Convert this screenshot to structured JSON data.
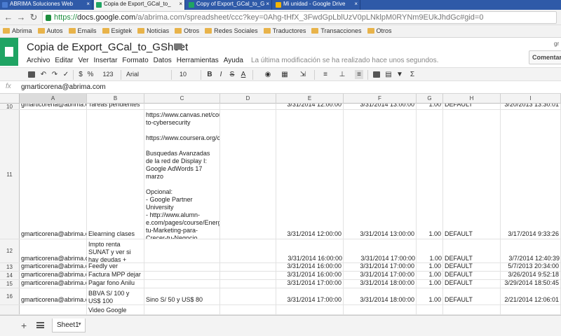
{
  "browser": {
    "tabs": [
      {
        "label": "ABRIMA Soluciones Web",
        "icon_color": "#4a7bd0",
        "active": false
      },
      {
        "label": "Copia de Export_GCal_to_",
        "icon_color": "#1fa463",
        "active": true
      },
      {
        "label": "Copy of Export_GCal_to_G",
        "icon_color": "#1fa463",
        "active": false
      },
      {
        "label": "Mi unidad - Google Drive",
        "icon_color": "#f4b400",
        "active": false
      }
    ],
    "url_scheme": "https://",
    "url_host": "docs.google.com",
    "url_path": "/a/abrima.com/spreadsheet/ccc?key=0Ahg-tHfX_3FwdGpLblUzV0pLNklpM0RYNm9EUkJhdGc#gid=0",
    "bookmarks": [
      "Abrima",
      "Autos",
      "Emails",
      "Esigtek",
      "Noticias",
      "Otros",
      "Redes Sociales",
      "Traductores",
      "Transacciones",
      "Otros"
    ]
  },
  "doc": {
    "title": "Copia de Export_GCal_to_GSheet",
    "menu": [
      "Archivo",
      "Editar",
      "Ver",
      "Insertar",
      "Formato",
      "Datos",
      "Herramientas",
      "Ayuda"
    ],
    "last_edit": "La última modificación se ha realizado hace unos segundos.",
    "comments_label": "Comentarios",
    "user_initials": "gr"
  },
  "toolbar": {
    "currency": "$",
    "percent": "%",
    "number_format": "123",
    "font": "Arial",
    "font_size": "10",
    "bold": "B",
    "italic": "I",
    "strike": "S",
    "text_color": "A",
    "sigma": "Σ"
  },
  "formula": {
    "fx": "fx",
    "value": "gmarticorena@abrima.com"
  },
  "columns": [
    "A",
    "B",
    "C",
    "D",
    "E",
    "F",
    "G",
    "H",
    "I"
  ],
  "rows": [
    {
      "num": "10",
      "cells": [
        "gmarticorena@abrima.co",
        "Tareas pendientes",
        "",
        "",
        "3/31/2014 12:00:00",
        "3/31/2014 13:00:00",
        "1.00",
        "DEFAULT",
        "3/20/2013 13:30:01"
      ]
    },
    {
      "num": "11",
      "cells": [
        "gmarticorena@abrima.co",
        "Elearning clases",
        "https://www.canvas.net/courses/intro-to-cybersecurity\n\nhttps://www.coursera.org/course\n\nBusquedas Avanzadas de la red de Display I: Google AdWords 17 marzo\n\nOpcional:\n- Google Partner University\n- http://www.alumn-e.com/pages/course/Energia-tu-Marketing-para-Crecer-tu-Negocio\n- Si no hay que hacer http://unimooc.com/",
        "",
        "3/31/2014 12:00:00",
        "3/31/2014 13:00:00",
        "1.00",
        "DEFAULT",
        "3/17/2014 9:33:26"
      ]
    },
    {
      "num": "12",
      "cells": [
        "",
        "Impto renta SUNAT y ver si hay deudas + chequera",
        "",
        "",
        "",
        "",
        "",
        "",
        ""
      ]
    },
    {
      "num": "13",
      "cells": [
        "gmarticorena@abrima.co",
        "Feedly ver",
        "",
        "",
        "3/31/2014 16:00:00",
        "3/31/2014 17:00:00",
        "1.00",
        "DEFAULT",
        "5/7/2013 20:34:00"
      ]
    },
    {
      "num": "14",
      "cells": [
        "gmarticorena@abrima.co",
        "Factura MPP dejar",
        "",
        "",
        "3/31/2014 16:00:00",
        "3/31/2014 17:00:00",
        "1.00",
        "DEFAULT",
        "3/26/2014 9:52:18"
      ]
    },
    {
      "num": "15",
      "cells": [
        "gmarticorena@abrima.co",
        "Pagar fono Anilu",
        "",
        "",
        "3/31/2014 17:00:00",
        "3/31/2014 18:00:00",
        "1.00",
        "DEFAULT",
        "3/29/2014 18:50:45"
      ]
    },
    {
      "num": "16",
      "cells": [
        "gmarticorena@abrima.co",
        "BBVA S/ 100 y US$ 100",
        "Sino S/ 50 y US$ 80",
        "",
        "3/31/2014 17:00:00",
        "3/31/2014 18:00:00",
        "1.00",
        "DEFAULT",
        "2/21/2014 12:06:01"
      ]
    },
    {
      "num": "",
      "cells": [
        "",
        "Video Google Adwords Búsqueda",
        "",
        "",
        "",
        "",
        "",
        "",
        ""
      ]
    }
  ],
  "row12_extra": {
    "e": "3/31/2014 16:00:00",
    "f": "3/31/2014 17:00:00",
    "g": "1.00",
    "h": "DEFAULT",
    "i": "3/7/2014 12:40:39",
    "a": "gmarticorena@abrima.co"
  },
  "sheet_tab": "Sheet1"
}
